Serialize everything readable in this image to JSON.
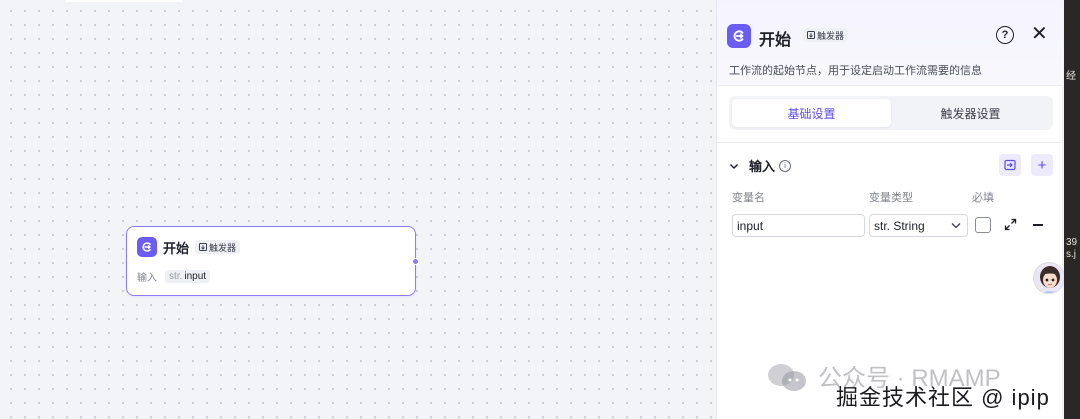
{
  "node": {
    "title": "开始",
    "badge": "触发器",
    "input_label": "输入",
    "input_type": "str.",
    "input_name": "input"
  },
  "panel": {
    "title": "开始",
    "badge": "触发器",
    "description": "工作流的起始节点，用于设定启动工作流需要的信息",
    "help_icon": "?",
    "close_icon": "✕",
    "tabs": [
      {
        "label": "基础设置",
        "active": true
      },
      {
        "label": "触发器设置",
        "active": false
      }
    ],
    "section": {
      "label": "输入",
      "info_icon": "i",
      "columns": {
        "name": "变量名",
        "type": "变量类型",
        "required": "必填"
      },
      "row": {
        "name_value": "input",
        "type_value": "str. String",
        "required": false
      },
      "add_icon": "+"
    }
  },
  "watermark": {
    "line1": "公众号 · RMAMP",
    "line2": "掘金技术社区 @ ipip"
  },
  "right_strip": {
    "text1": "经",
    "text2": "39",
    "text3": "s.j"
  },
  "colors": {
    "accent": "#6b5cf6",
    "accent_text": "#5a4cf2"
  }
}
